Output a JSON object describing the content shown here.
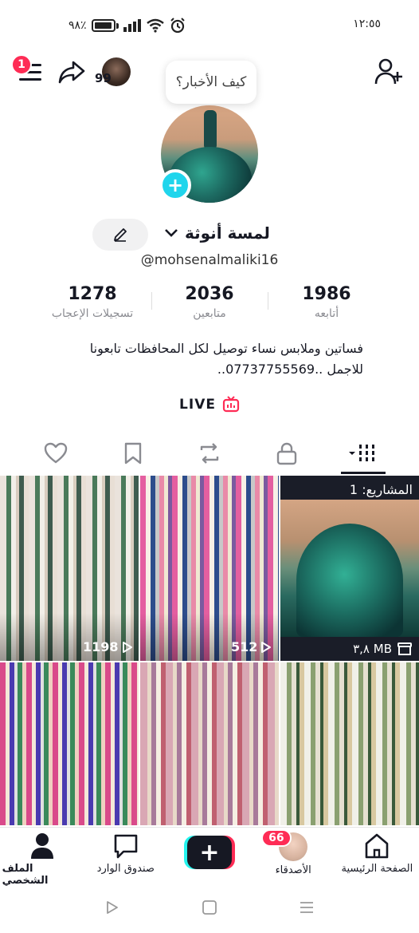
{
  "status_bar": {
    "time": "١٢:٥٥",
    "battery": "٩٨٪"
  },
  "header": {
    "notification_count": "1",
    "story_count": "99",
    "bubble_text": "كيف الأخبار؟"
  },
  "profile": {
    "display_name": "لمسة أنوثة",
    "username": "@mohsenalmaliki16",
    "stats": [
      {
        "value": "1986",
        "label": "أتابعه"
      },
      {
        "value": "2036",
        "label": "متابعين"
      },
      {
        "value": "1278",
        "label": "تسجيلات الإعجاب"
      }
    ],
    "bio_line1": "فساتين وملابس نساء توصيل لكل المحافظات تابعونا",
    "bio_line2": "للاجمل ..07737755569..",
    "live_label": "LIVE"
  },
  "tabs": [
    "videos-grid",
    "private",
    "reposts",
    "favorites",
    "liked"
  ],
  "grid": {
    "projects_label": "المشاريع: 1",
    "projects_size": "٣,٨ MB",
    "views": [
      "512",
      "1198"
    ]
  },
  "bottom_nav": {
    "home": "الصفحة الرئيسية",
    "friends": "الأصدقاء",
    "friends_badge": "66",
    "inbox": "صندوق الوارد",
    "profile": "الملف الشخصي"
  },
  "colors": {
    "accent_red": "#fe2c55",
    "accent_cyan": "#25f4ee",
    "text": "#161823"
  }
}
